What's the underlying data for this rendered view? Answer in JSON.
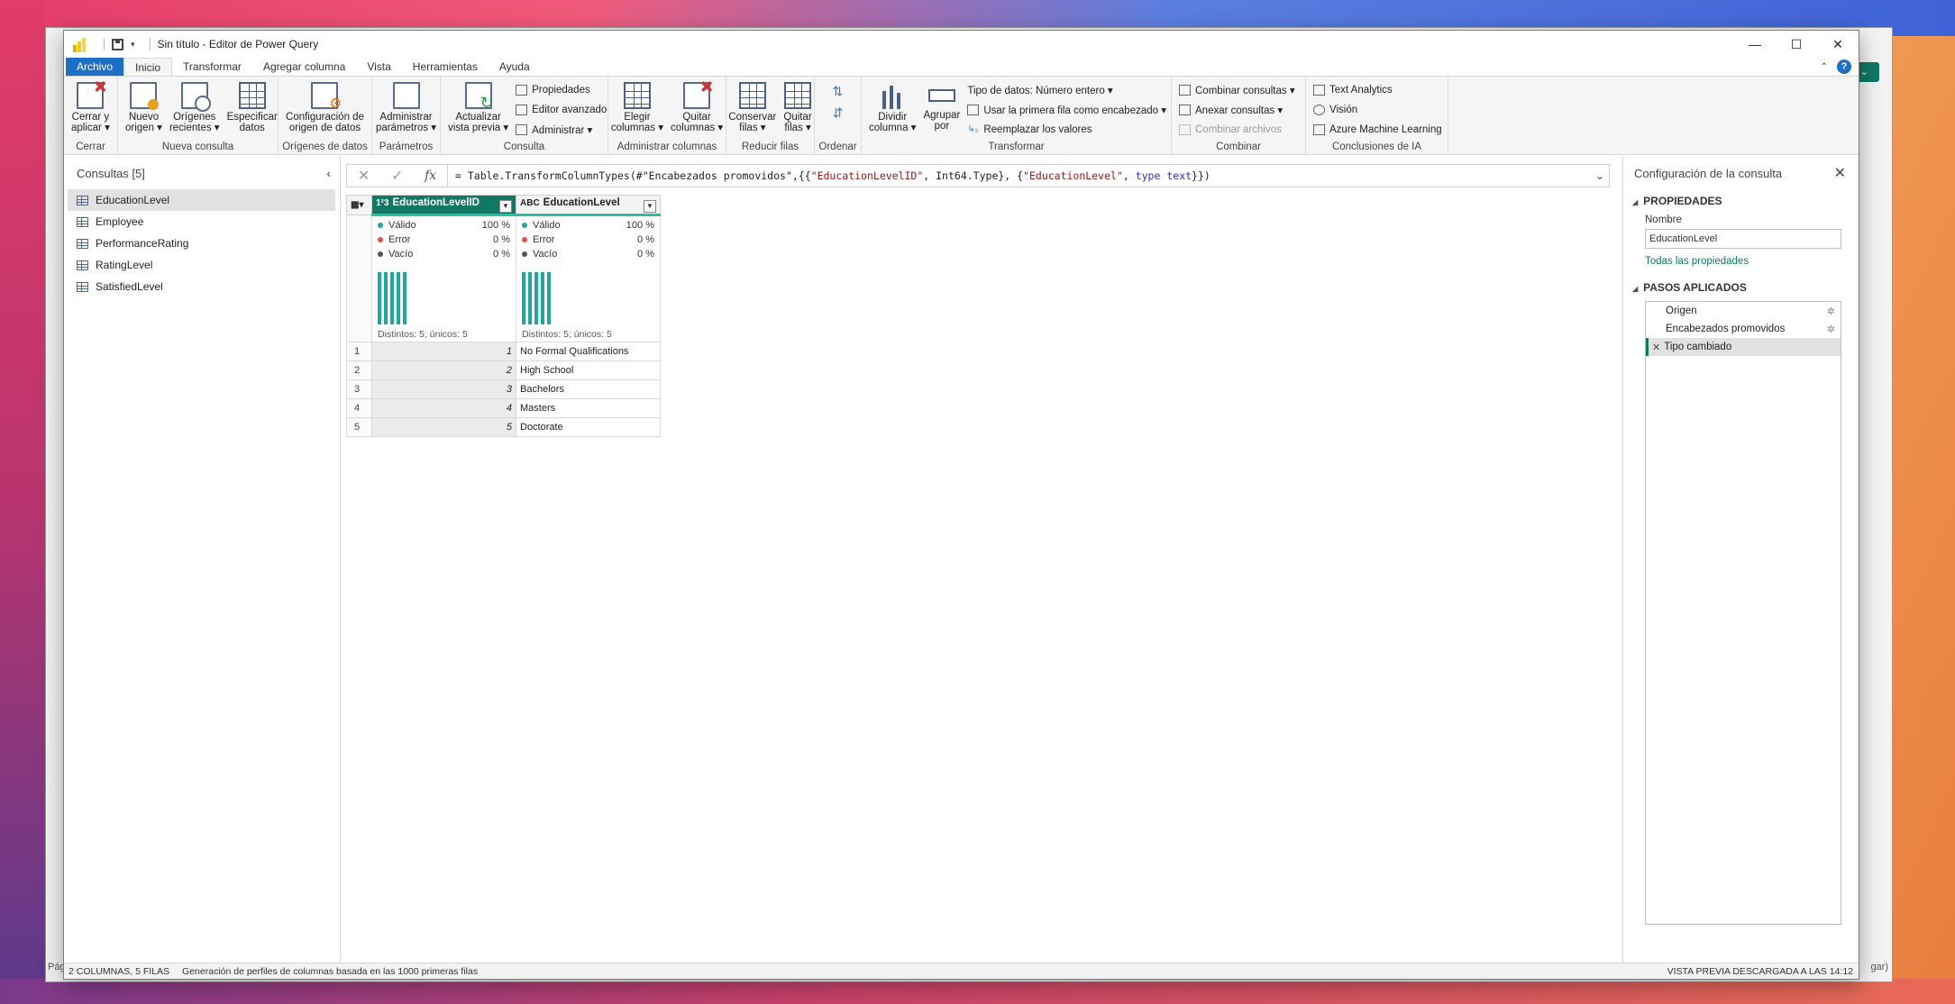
{
  "window": {
    "title": "Sin título - Editor de Power Query"
  },
  "window_controls": {
    "minimize": "—",
    "maximize": "☐",
    "close": "✕"
  },
  "tabs": [
    "Archivo",
    "Inicio",
    "Transformar",
    "Agregar columna",
    "Vista",
    "Herramientas",
    "Ayuda"
  ],
  "ribbon": {
    "cerrar": {
      "btn1": "Cerrar y",
      "btn1b": "aplicar ▾",
      "label": "Cerrar"
    },
    "nueva": {
      "b1": "Nuevo",
      "b1b": "origen ▾",
      "b2": "Orígenes",
      "b2b": "recientes ▾",
      "b3": "Especificar",
      "b3b": "datos",
      "label": "Nueva consulta"
    },
    "origenes": {
      "b1": "Configuración de",
      "b1b": "origen de datos",
      "label": "Orígenes de datos"
    },
    "parametros": {
      "b1": "Administrar",
      "b1b": "parámetros ▾",
      "label": "Parámetros"
    },
    "consulta": {
      "b1": "Actualizar",
      "b1b": "vista previa ▾",
      "s1": "Propiedades",
      "s2": "Editor avanzado",
      "s3": "Administrar ▾",
      "label": "Consulta"
    },
    "admincol": {
      "b1": "Elegir",
      "b1b": "columnas ▾",
      "b2": "Quitar",
      "b2b": "columnas ▾",
      "label": "Administrar columnas"
    },
    "reducir": {
      "b1": "Conservar",
      "b1b": "filas ▾",
      "b2": "Quitar",
      "b2b": "filas ▾",
      "label": "Reducir filas"
    },
    "ordenar": {
      "label": "Ordenar"
    },
    "transformar": {
      "b1": "Dividir",
      "b1b": "columna ▾",
      "b2": "Agrupar",
      "b2b": "por",
      "s1": "Tipo de datos: Número entero ▾",
      "s2": "Usar la primera fila como encabezado ▾",
      "s3": "Reemplazar los valores",
      "label": "Transformar"
    },
    "combinar": {
      "s1": "Combinar consultas ▾",
      "s2": "Anexar consultas ▾",
      "s3": "Combinar archivos",
      "label": "Combinar"
    },
    "ia": {
      "s1": "Text Analytics",
      "s2": "Visión",
      "s3": "Azure Machine Learning",
      "label": "Conclusiones de IA"
    }
  },
  "queries": {
    "header": "Consultas [5]",
    "items": [
      "EducationLevel",
      "Employee",
      "PerformanceRating",
      "RatingLevel",
      "SatisfiedLevel"
    ]
  },
  "formula": {
    "prefix": "= Table.TransformColumnTypes(#\"Encabezados promovidos\",{{",
    "s1": "\"EducationLevelID\"",
    "mid1": ", Int64.Type}, {",
    "s2": "\"EducationLevel\"",
    "mid2": ", ",
    "kw1": "type",
    "mid3": " ",
    "kw2": "text",
    "suffix": "}})"
  },
  "grid": {
    "columns": [
      {
        "name": "EducationLevelID",
        "type": "1²3"
      },
      {
        "name": "EducationLevel",
        "type": "ABC"
      }
    ],
    "profile_labels": {
      "valid": "Válido",
      "error": "Error",
      "empty": "Vacío"
    },
    "profiles": [
      {
        "valid": "100 %",
        "error": "0 %",
        "empty": "0 %",
        "distinct": "Distintos: 5; únicos: 5"
      },
      {
        "valid": "100 %",
        "error": "0 %",
        "empty": "0 %",
        "distinct": "Distintos: 5; únicos: 5"
      }
    ],
    "rows": [
      {
        "idx": "1",
        "id": "1",
        "level": "No Formal Qualifications"
      },
      {
        "idx": "2",
        "id": "2",
        "level": "High School"
      },
      {
        "idx": "3",
        "id": "3",
        "level": "Bachelors"
      },
      {
        "idx": "4",
        "id": "4",
        "level": "Masters"
      },
      {
        "idx": "5",
        "id": "5",
        "level": "Doctorate"
      }
    ]
  },
  "settings": {
    "header": "Configuración de la consulta",
    "properties": "PROPIEDADES",
    "name_label": "Nombre",
    "name_value": "EducationLevel",
    "all_props": "Todas las propiedades",
    "steps_header": "PASOS APLICADOS",
    "steps": [
      "Origen",
      "Encabezados promovidos",
      "Tipo cambiado"
    ]
  },
  "status": {
    "left": "2 COLUMNAS, 5 FILAS",
    "profile": "Generación de perfiles de columnas basada en las 1000 primeras filas",
    "right": "VISTA PREVIA DESCARGADA A LAS 14:12"
  },
  "background_app": {
    "status_left": "Pág",
    "status_right": "gar)"
  },
  "colors": {
    "accent": "#117865",
    "file_tab": "#1f6fc5",
    "valid": "#22a89a",
    "error": "#e05050",
    "empty": "#555555"
  }
}
